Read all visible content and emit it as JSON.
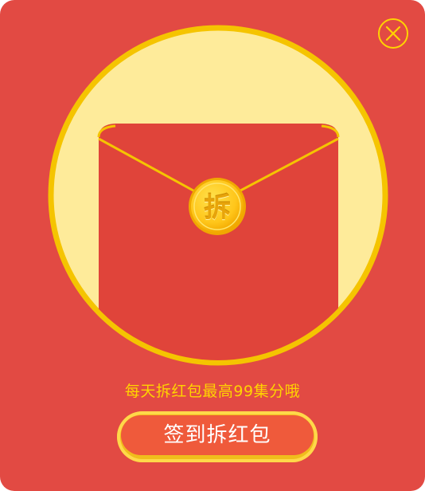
{
  "dialog": {
    "open_seal_label": "拆",
    "promo_text": "每天拆红包最高99集分哦",
    "sign_button_label": "签到拆红包",
    "close_icon": "close-icon"
  },
  "colors": {
    "background": "#e24a43",
    "circle_fill": "#feeb9a",
    "circle_border": "#f5c400",
    "envelope": "#e0443a",
    "coin": "#ffc61a",
    "promo_text": "#ffd400",
    "button_fill": "#ef5a3b",
    "button_border": "#f0bd1c"
  }
}
